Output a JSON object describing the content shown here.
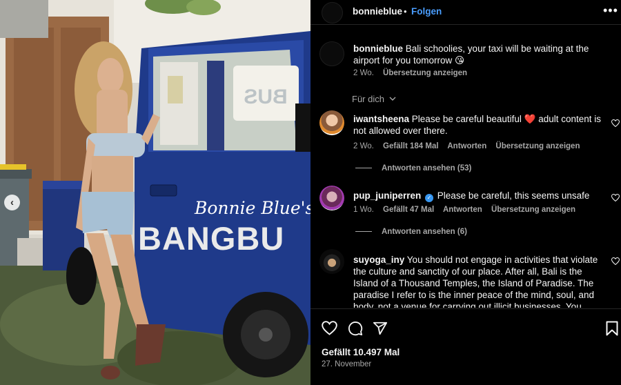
{
  "post": {
    "username": "bonnieblue",
    "separator": "•",
    "follow_label": "Folgen",
    "more_label": "•••",
    "photo": {
      "alt": "Woman standing next to blue truck",
      "truck_script": "Bonnie Blue's",
      "truck_block": "BANGBU",
      "window_text": "BUS",
      "nav_prev": "‹"
    }
  },
  "caption": {
    "username": "bonnieblue",
    "text": "Bali schoolies, your taxi will be waiting at the airport for you tomorrow 😘",
    "time": "2 Wo.",
    "translate": "Übersetzung anzeigen"
  },
  "for_you_label": "Für dich",
  "comments": [
    {
      "username": "iwantsheena",
      "text": "Please be careful beautiful ❤️ adult content is not allowed over there.",
      "time": "2 Wo.",
      "likes": "Gefällt 184 Mal",
      "reply": "Antworten",
      "translate": "Übersetzung anzeigen",
      "view_replies": "Antworten ansehen (53)",
      "verified": false
    },
    {
      "username": "pup_juniperren",
      "text": "Please be careful, this seems unsafe",
      "time": "1 Wo.",
      "likes": "Gefällt 47 Mal",
      "reply": "Antworten",
      "translate": "Übersetzung anzeigen",
      "view_replies": "Antworten ansehen (6)",
      "verified": true
    },
    {
      "username": "suyoga_iny",
      "text": "You should not engage in activities that violate the culture and sanctity of our place. After all, Bali is the Island of a Thousand Temples, the Island of Paradise. The paradise I refer to is the inner peace of the mind, soul, and body, not a venue for carrying out illicit businesses. You",
      "verified": false
    }
  ],
  "footer": {
    "likes": "Gefällt 10.497 Mal",
    "date": "27. November"
  },
  "colors": {
    "background": "#000000",
    "link_blue": "#4a9eff",
    "muted": "#a8a8a8",
    "truck_blue": "#1f3a8a"
  }
}
